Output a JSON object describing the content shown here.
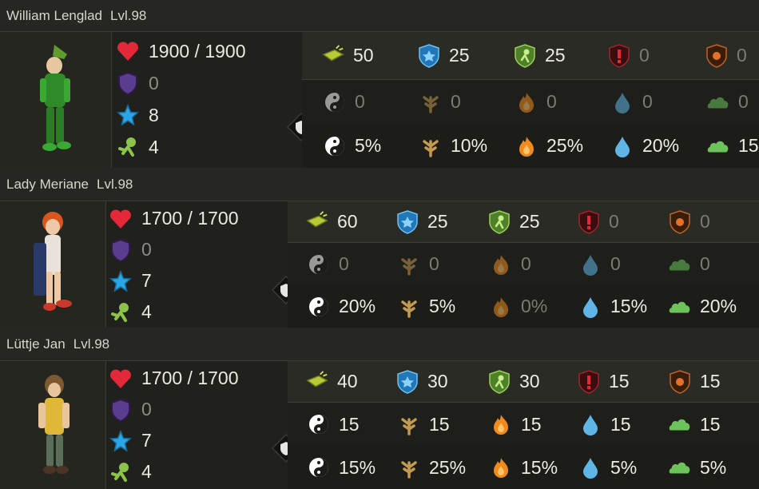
{
  "characters": [
    {
      "name": "William Lenglad",
      "level": "Lvl.98",
      "hp": "1900 / 1900",
      "shield": "0",
      "ap": "8",
      "mp": "4",
      "top": [
        {
          "icon": "ap-reduction-icon",
          "value": "50"
        },
        {
          "icon": "ap-resist-icon",
          "value": "25"
        },
        {
          "icon": "mp-resist-icon",
          "value": "25"
        },
        {
          "icon": "critical-resist-icon",
          "value": "0"
        },
        {
          "icon": "pushback-resist-icon",
          "value": "0"
        }
      ],
      "flat": [
        {
          "icon": "neutral-icon",
          "value": "0"
        },
        {
          "icon": "earth-icon",
          "value": "0"
        },
        {
          "icon": "fire-icon",
          "value": "0"
        },
        {
          "icon": "water-icon",
          "value": "0"
        },
        {
          "icon": "air-icon",
          "value": "0"
        }
      ],
      "percent": [
        {
          "icon": "neutral-icon",
          "value": "5%"
        },
        {
          "icon": "earth-icon",
          "value": "10%"
        },
        {
          "icon": "fire-icon",
          "value": "25%"
        },
        {
          "icon": "water-icon",
          "value": "20%"
        },
        {
          "icon": "air-icon",
          "value": "15"
        }
      ]
    },
    {
      "name": "Lady Meriane",
      "level": "Lvl.98",
      "hp": "1700 / 1700",
      "shield": "0",
      "ap": "7",
      "mp": "4",
      "top": [
        {
          "icon": "ap-reduction-icon",
          "value": "60"
        },
        {
          "icon": "ap-resist-icon",
          "value": "25"
        },
        {
          "icon": "mp-resist-icon",
          "value": "25"
        },
        {
          "icon": "critical-resist-icon",
          "value": "0"
        },
        {
          "icon": "pushback-resist-icon",
          "value": "0"
        }
      ],
      "flat": [
        {
          "icon": "neutral-icon",
          "value": "0"
        },
        {
          "icon": "earth-icon",
          "value": "0"
        },
        {
          "icon": "fire-icon",
          "value": "0"
        },
        {
          "icon": "water-icon",
          "value": "0"
        },
        {
          "icon": "air-icon",
          "value": "0"
        }
      ],
      "percent": [
        {
          "icon": "neutral-icon",
          "value": "20%"
        },
        {
          "icon": "earth-icon",
          "value": "5%"
        },
        {
          "icon": "fire-icon",
          "value": "0%"
        },
        {
          "icon": "water-icon",
          "value": "15%"
        },
        {
          "icon": "air-icon",
          "value": "20%"
        }
      ]
    },
    {
      "name": "Lüttje Jan",
      "level": "Lvl.98",
      "hp": "1700 / 1700",
      "shield": "0",
      "ap": "7",
      "mp": "4",
      "top": [
        {
          "icon": "ap-reduction-icon",
          "value": "40"
        },
        {
          "icon": "ap-resist-icon",
          "value": "30"
        },
        {
          "icon": "mp-resist-icon",
          "value": "30"
        },
        {
          "icon": "critical-resist-icon",
          "value": "15"
        },
        {
          "icon": "pushback-resist-icon",
          "value": "15"
        }
      ],
      "flat": [
        {
          "icon": "neutral-icon",
          "value": "15"
        },
        {
          "icon": "earth-icon",
          "value": "15"
        },
        {
          "icon": "fire-icon",
          "value": "15"
        },
        {
          "icon": "water-icon",
          "value": "15"
        },
        {
          "icon": "air-icon",
          "value": "15"
        }
      ],
      "percent": [
        {
          "icon": "neutral-icon",
          "value": "15%"
        },
        {
          "icon": "earth-icon",
          "value": "25%"
        },
        {
          "icon": "fire-icon",
          "value": "15%"
        },
        {
          "icon": "water-icon",
          "value": "5%"
        },
        {
          "icon": "air-icon",
          "value": "5%"
        }
      ]
    }
  ],
  "colors": {
    "heart": "#e3283a",
    "shield": "#5b3d8f",
    "ap_star": "#2aa6e8",
    "mp_runner": "#8cc34a",
    "neutral": "#ffffff",
    "earth": "#c49a50",
    "fire": "#f08a1c",
    "water": "#5fb6e6",
    "air": "#6cc35a"
  }
}
